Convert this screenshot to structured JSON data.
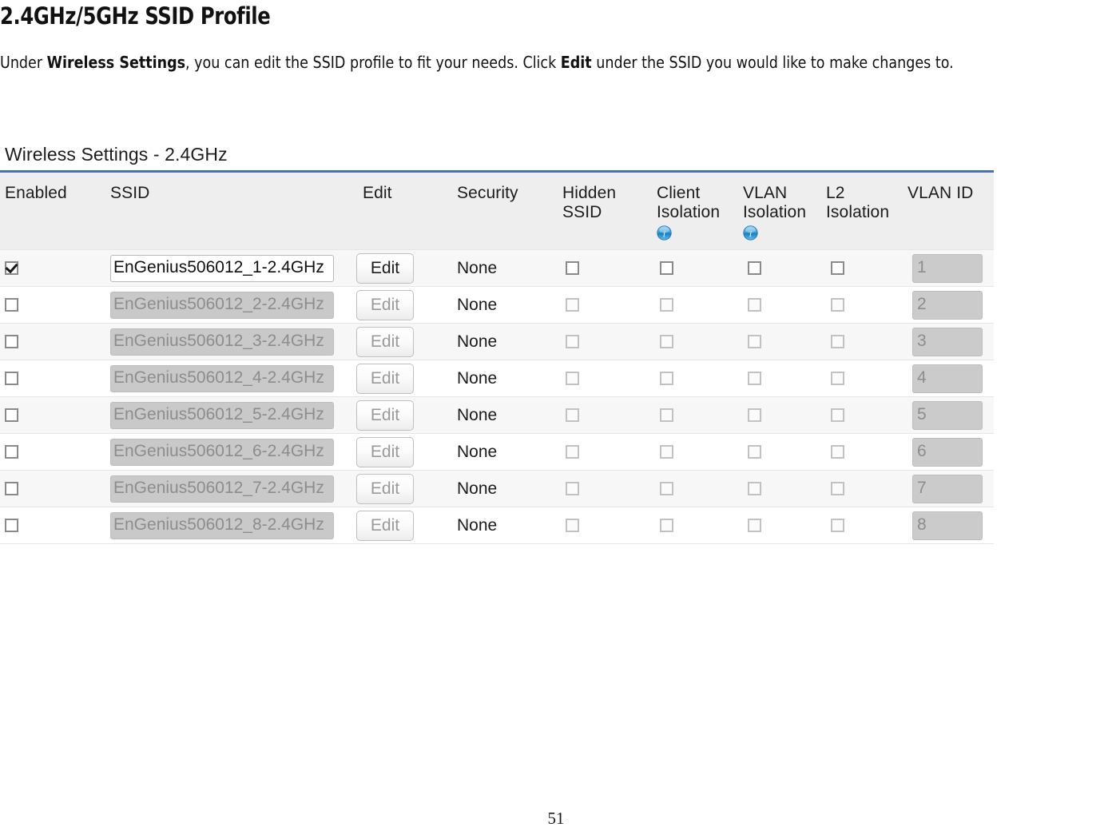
{
  "document": {
    "heading": "2.4GHz/5GHz SSID Profile",
    "paragraph": {
      "part1": "Under ",
      "bold1": "Wireless Settings",
      "part2": ", you can edit the SSID profile to fit your needs. Click ",
      "bold2": "Edit",
      "part3": " under the SSID you would like to make changes to."
    },
    "page_number": "51"
  },
  "panel": {
    "title": "Wireless Settings - 2.4GHz",
    "accent_color": "#4a6fb5",
    "header_bg": "#eeeeee",
    "columns": [
      {
        "key": "enabled",
        "label": "Enabled"
      },
      {
        "key": "ssid",
        "label": "SSID"
      },
      {
        "key": "edit",
        "label": "Edit"
      },
      {
        "key": "security",
        "label": "Security"
      },
      {
        "key": "hidden",
        "label_line1": "Hidden",
        "label_line2": "SSID"
      },
      {
        "key": "client",
        "label_line1": "Client",
        "label_line2": "Isolation",
        "info_icon": "info-icon"
      },
      {
        "key": "vlaniso",
        "label_line1": "VLAN",
        "label_line2": "Isolation",
        "info_icon": "info-icon"
      },
      {
        "key": "l2",
        "label_line1": "L2",
        "label_line2": "Isolation"
      },
      {
        "key": "vlanid",
        "label": "VLAN ID"
      }
    ],
    "edit_button_label": "Edit",
    "rows": [
      {
        "enabled": true,
        "ssid": "EnGenius506012_1-2.4GHz",
        "security": "None",
        "hidden": false,
        "client": false,
        "vlaniso": false,
        "l2": false,
        "vlanid": "1",
        "disabled": false
      },
      {
        "enabled": false,
        "ssid": "EnGenius506012_2-2.4GHz",
        "security": "None",
        "hidden": false,
        "client": false,
        "vlaniso": false,
        "l2": false,
        "vlanid": "2",
        "disabled": true
      },
      {
        "enabled": false,
        "ssid": "EnGenius506012_3-2.4GHz",
        "security": "None",
        "hidden": false,
        "client": false,
        "vlaniso": false,
        "l2": false,
        "vlanid": "3",
        "disabled": true
      },
      {
        "enabled": false,
        "ssid": "EnGenius506012_4-2.4GHz",
        "security": "None",
        "hidden": false,
        "client": false,
        "vlaniso": false,
        "l2": false,
        "vlanid": "4",
        "disabled": true
      },
      {
        "enabled": false,
        "ssid": "EnGenius506012_5-2.4GHz",
        "security": "None",
        "hidden": false,
        "client": false,
        "vlaniso": false,
        "l2": false,
        "vlanid": "5",
        "disabled": true
      },
      {
        "enabled": false,
        "ssid": "EnGenius506012_6-2.4GHz",
        "security": "None",
        "hidden": false,
        "client": false,
        "vlaniso": false,
        "l2": false,
        "vlanid": "6",
        "disabled": true
      },
      {
        "enabled": false,
        "ssid": "EnGenius506012_7-2.4GHz",
        "security": "None",
        "hidden": false,
        "client": false,
        "vlaniso": false,
        "l2": false,
        "vlanid": "7",
        "disabled": true
      },
      {
        "enabled": false,
        "ssid": "EnGenius506012_8-2.4GHz",
        "security": "None",
        "hidden": false,
        "client": false,
        "vlaniso": false,
        "l2": false,
        "vlanid": "8",
        "disabled": true
      }
    ]
  }
}
